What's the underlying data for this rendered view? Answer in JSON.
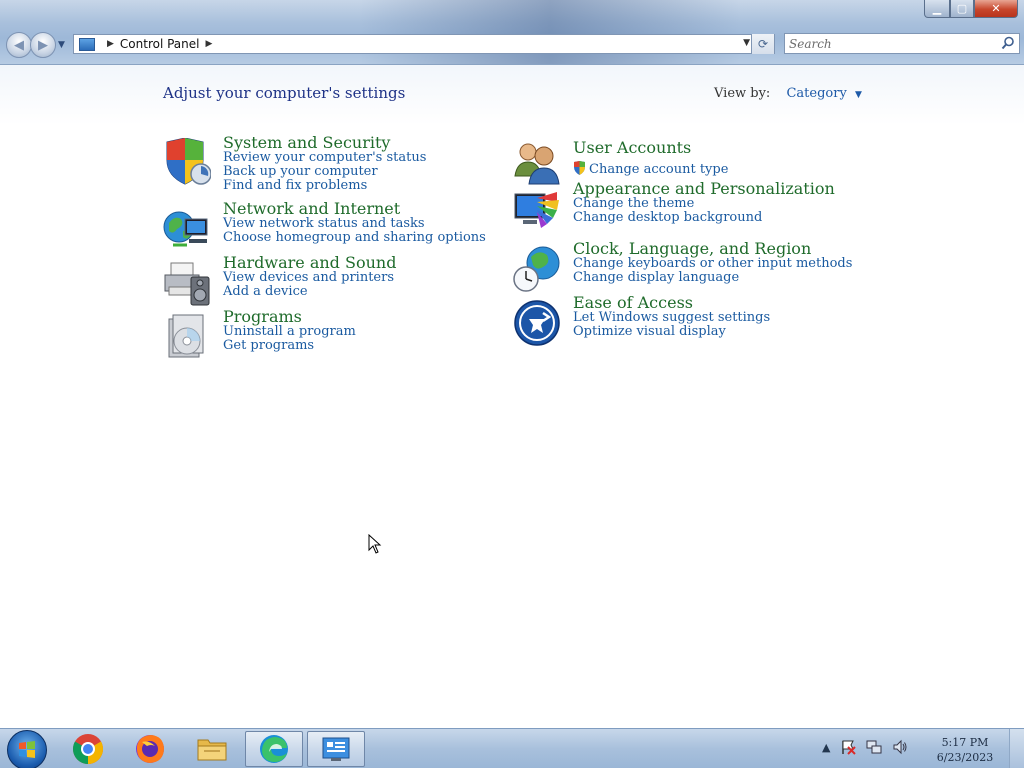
{
  "window": {
    "minimize_icon": "minimize-icon",
    "maximize_icon": "maximize-icon",
    "close_icon": "close-icon"
  },
  "address_bar": {
    "crumbs": [
      "Control Panel"
    ]
  },
  "search": {
    "placeholder": "Search"
  },
  "page": {
    "title": "Adjust your computer's settings",
    "view_by_label": "View by:",
    "view_by_value": "Category"
  },
  "categories": [
    {
      "title": "System and Security",
      "icon": "shield-icon",
      "links": [
        "Review your computer's status",
        "Back up your computer",
        "Find and fix problems"
      ]
    },
    {
      "title": "Network and Internet",
      "icon": "network-globe-icon",
      "links": [
        "View network status and tasks",
        "Choose homegroup and sharing options"
      ]
    },
    {
      "title": "Hardware and Sound",
      "icon": "printer-speaker-icon",
      "links": [
        "View devices and printers",
        "Add a device"
      ]
    },
    {
      "title": "Programs",
      "icon": "programs-disc-icon",
      "links": [
        "Uninstall a program",
        "Get programs"
      ]
    },
    {
      "title": "User Accounts",
      "icon": "users-icon",
      "links": [
        "Change account type"
      ]
    },
    {
      "title": "Appearance and Personalization",
      "icon": "monitor-palette-icon",
      "links": [
        "Change the theme",
        "Change desktop background"
      ]
    },
    {
      "title": "Clock, Language, and Region",
      "icon": "clock-globe-icon",
      "links": [
        "Change keyboards or other input methods",
        "Change display language"
      ]
    },
    {
      "title": "Ease of Access",
      "icon": "ease-of-access-icon",
      "links": [
        "Let Windows suggest settings",
        "Optimize visual display"
      ]
    }
  ],
  "taskbar": {
    "items": [
      "chrome-icon",
      "firefox-icon",
      "file-explorer-icon",
      "edge-icon",
      "control-panel-icon"
    ],
    "tray_icons": [
      "show-hidden-icons",
      "action-center-flag-icon",
      "network-icon",
      "volume-icon"
    ],
    "time": "5:17 PM",
    "date": "6/23/2023"
  },
  "colors": {
    "category_title": "#1f6b2b",
    "link": "#1a5aa0",
    "page_title": "#1e3287"
  }
}
